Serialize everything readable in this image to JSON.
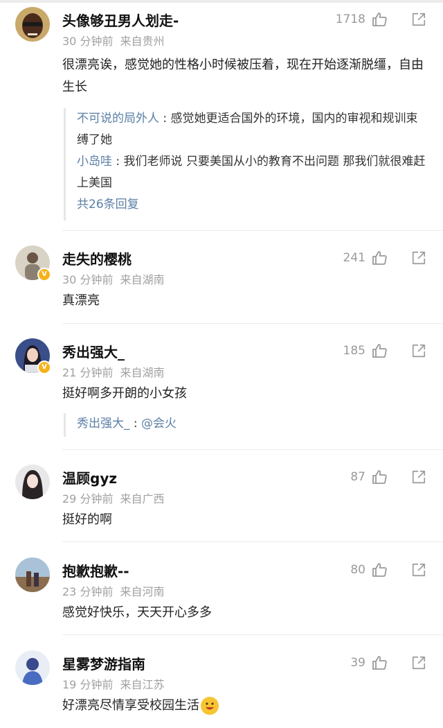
{
  "comments": [
    {
      "username": "头像够丑男人划走-",
      "time": "30 分钟前",
      "location": "来自贵州",
      "likes": "1718",
      "text": "很漂亮诶，感觉她的性格小时候被压着，现在开始逐渐脱缰，自由生长",
      "verified": false,
      "replies": [
        {
          "user": "不可说的局外人",
          "text": "感觉她更适合国外的环境，国内的审视和规训束缚了她"
        },
        {
          "user": "小岛哇",
          "text": "我们老师说 只要美国从小的教育不出问题 那我们就很难赶上美国"
        }
      ],
      "reply_count": "共26条回复"
    },
    {
      "username": "走失的樱桃",
      "time": "30 分钟前",
      "location": "来自湖南",
      "likes": "241",
      "text": "真漂亮",
      "verified": true
    },
    {
      "username": "秀出强大_",
      "time": "21 分钟前",
      "location": "来自湖南",
      "likes": "185",
      "text": "挺好啊多开朗的小女孩",
      "verified": true,
      "replies": [
        {
          "user": "秀出强大_",
          "text": "@会火"
        }
      ]
    },
    {
      "username": "温顾gyz",
      "time": "29 分钟前",
      "location": "来自广西",
      "likes": "87",
      "text": "挺好的啊",
      "verified": false
    },
    {
      "username": "抱歉抱歉--",
      "time": "23 分钟前",
      "location": "来自河南",
      "likes": "80",
      "text": "感觉好快乐，天天开心多多",
      "verified": false
    },
    {
      "username": "星雾梦游指南",
      "time": "19 分钟前",
      "location": "来自江苏",
      "likes": "39",
      "text": "好漂亮尽情享受校园生活",
      "verified": false,
      "emoji": "happy-face-emoji"
    }
  ],
  "icons": {
    "like": "thumbs-up-icon",
    "share": "share-icon"
  },
  "colors": {
    "link": "#5b7fa6",
    "meta": "#a0a0a0",
    "badge": "#f6b21a"
  }
}
